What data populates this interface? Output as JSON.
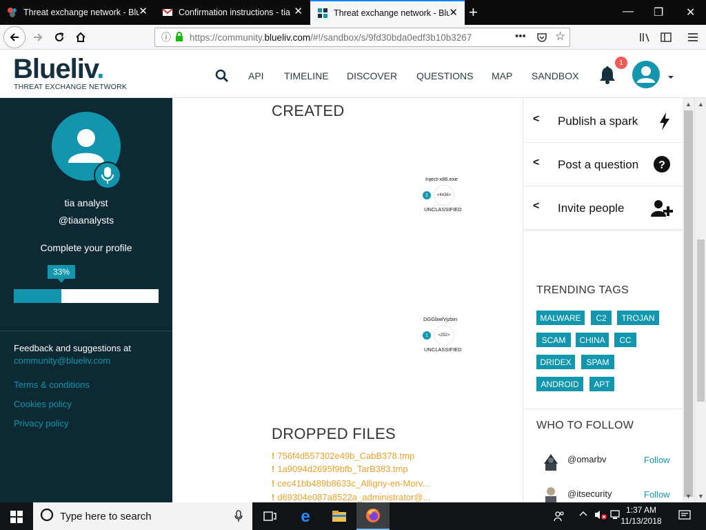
{
  "browser": {
    "tabs": [
      {
        "title": "Threat exchange network - Blue",
        "active": false
      },
      {
        "title": "Confirmation instructions - tia",
        "active": false
      },
      {
        "title": "Threat exchange network - Blue",
        "active": true
      }
    ],
    "url_prefix": "https://community.",
    "url_host": "blueliv.com",
    "url_path": "/#!/sandbox/s/9fd30bda0edf3b10b3267"
  },
  "header": {
    "logo": "Blueliv",
    "logo_dot": ".",
    "logo_sub": "THREAT EXCHANGE NETWORK",
    "nav": [
      "API",
      "TIMELINE",
      "DISCOVER",
      "QUESTIONS",
      "MAP",
      "SANDBOX"
    ],
    "notifications": "1"
  },
  "sidebar": {
    "name": "tia analyst",
    "handle": "@tiaanalysts",
    "complete_label": "Complete your profile",
    "progress_label": "33%",
    "progress": 0.33,
    "feedback_text": "Feedback and suggestions at",
    "feedback_link": "community@blueliv.com",
    "links": [
      "Terms & conditions",
      "Cookies policy",
      "Privacy policy"
    ]
  },
  "main": {
    "created_title": "CREATED",
    "nodes": [
      {
        "name": "Inject-x86.exe",
        "center": "<4436>",
        "count": "2",
        "class": "UNCLASSIFIED"
      },
      {
        "name": "DGGbwIVjzbin",
        "center": "<292>",
        "count": "1",
        "class": "UNCLASSIFIED"
      }
    ],
    "dropped_title": "DROPPED FILES",
    "files": [
      "756f4d557302e49b_CabB378.tmp",
      "1a9094d2695f9bfb_TarB383.tmp",
      "cec41bb489b8633c_Alligny-en-Morv...",
      "d69304e087a8522a_administrator@..."
    ]
  },
  "right": {
    "actions": [
      {
        "label": "Publish a spark",
        "icon": "lightning-icon"
      },
      {
        "label": "Post a question",
        "icon": "question-circle-icon"
      },
      {
        "label": "Invite people",
        "icon": "add-user-icon"
      }
    ],
    "trending_title": "TRENDING TAGS",
    "tags": [
      "MALWARE",
      "C2",
      "TROJAN",
      "SCAM",
      "CHINA",
      "CC",
      "DRIDEX",
      "SPAM",
      "ANDROID",
      "APT"
    ],
    "follow_title": "WHO TO FOLLOW",
    "follow": [
      {
        "name": "@omarbv",
        "button": "Follow"
      },
      {
        "name": "@itsecurity",
        "button": "Follow"
      }
    ]
  },
  "taskbar": {
    "search_placeholder": "Type here to search",
    "time": "1:37 AM",
    "date": "11/13/2018"
  }
}
